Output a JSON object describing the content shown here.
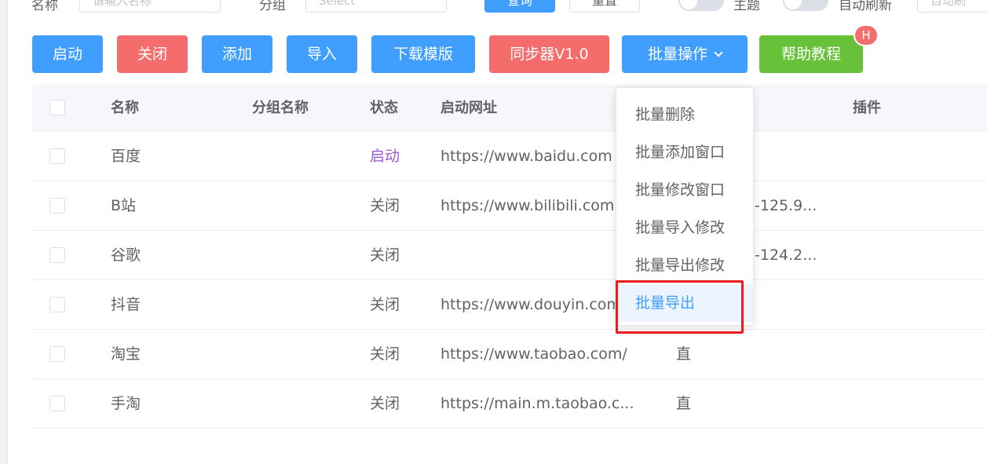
{
  "filters": {
    "name_label": "名称",
    "name_placeholder": "请输入名称",
    "group_label": "分组",
    "group_placeholder": "Select",
    "search_label": "查询",
    "reset_label": "重置",
    "switch1_label": "主题",
    "switch2_label": "自动刷新",
    "extra_label": "自动刷"
  },
  "toolbar": {
    "start": "启动",
    "close": "关闭",
    "add": "添加",
    "import": "导入",
    "download_template": "下载模版",
    "sync": "同步器V1.0",
    "batch": "批量操作",
    "help": "帮助教程",
    "help_badge": "H"
  },
  "table": {
    "headers": [
      "名称",
      "分组名称",
      "状态",
      "启动网址",
      "插件"
    ],
    "rows": [
      {
        "name": "百度",
        "group": "",
        "status": "启动",
        "url": "https://www.baidu.com",
        "extra": ""
      },
      {
        "name": "B站",
        "group": "",
        "status": "关闭",
        "url": "https://www.bilibili.com",
        "extra": "-125.9..."
      },
      {
        "name": "谷歌",
        "group": "",
        "status": "关闭",
        "url": "",
        "extra": "-124.2..."
      },
      {
        "name": "抖音",
        "group": "",
        "status": "关闭",
        "url": "https://www.douyin.com",
        "extra": ""
      },
      {
        "name": "淘宝",
        "group": "",
        "status": "关闭",
        "url": "https://www.taobao.com/",
        "extra": "直"
      },
      {
        "name": "手淘",
        "group": "",
        "status": "关闭",
        "url": "https://main.m.taobao.c...",
        "extra": "直"
      }
    ]
  },
  "dropdown": {
    "items": [
      "批量删除",
      "批量添加窗口",
      "批量修改窗口",
      "批量导入修改",
      "批量导出修改",
      "批量导出"
    ],
    "hovered_index": 5
  },
  "colors": {
    "primary": "#409eff",
    "danger": "#f56c6c",
    "success": "#67c23a",
    "highlight": "#ea1c1c"
  }
}
